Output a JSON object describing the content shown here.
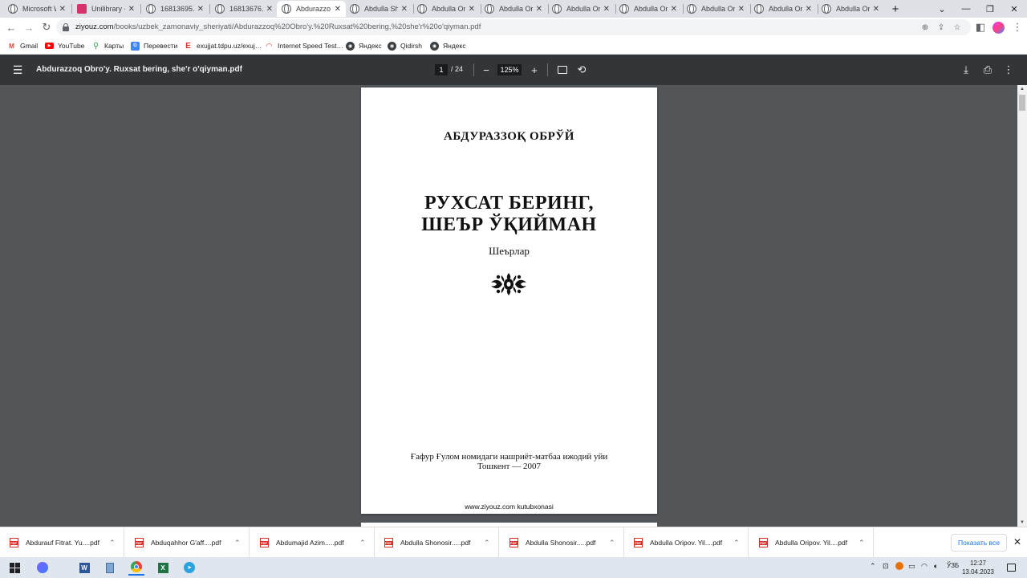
{
  "browser": {
    "tabs": [
      {
        "title": "Microsoft W",
        "icon": "globe-icon"
      },
      {
        "title": "Unilibrary -",
        "icon": "unilibrary-icon"
      },
      {
        "title": "16813695…",
        "icon": "globe-icon"
      },
      {
        "title": "16813676…",
        "icon": "globe-icon"
      },
      {
        "title": "Abdurazzo…",
        "icon": "globe-icon",
        "active": true
      },
      {
        "title": "Abdulla Sh",
        "icon": "globe-icon"
      },
      {
        "title": "Abdulla Ori",
        "icon": "globe-icon"
      },
      {
        "title": "Abdulla Ori",
        "icon": "globe-icon"
      },
      {
        "title": "Abdulla Ori",
        "icon": "globe-icon"
      },
      {
        "title": "Abdulla Ori",
        "icon": "globe-icon"
      },
      {
        "title": "Abdulla Ori",
        "icon": "globe-icon"
      },
      {
        "title": "Abdulla Ori",
        "icon": "globe-icon"
      },
      {
        "title": "Abdulla Ori",
        "icon": "globe-icon"
      }
    ],
    "new_tab_label": "+",
    "url_host": "ziyouz.com",
    "url_path": "/books/uzbek_zamonaviy_sheriyati/Abdurazzoq%20Obro'y.%20Ruxsat%20bering,%20she'r%20o'qiyman.pdf",
    "bookmarks": [
      {
        "label": "Gmail",
        "icon": "gmail-icon"
      },
      {
        "label": "YouTube",
        "icon": "youtube-icon"
      },
      {
        "label": "Карты",
        "icon": "maps-icon"
      },
      {
        "label": "Перевести",
        "icon": "translate-icon"
      },
      {
        "label": "exujjat.tdpu.uz/exuj…",
        "icon": "exujjat-icon"
      },
      {
        "label": "Internet Speed Test…",
        "icon": "speedtest-icon"
      },
      {
        "label": "Яндекс",
        "icon": "globe-icon"
      },
      {
        "label": "Qidirsh",
        "icon": "globe-icon"
      },
      {
        "label": "Яндекс",
        "icon": "globe-icon"
      }
    ]
  },
  "pdf_viewer": {
    "file_title": "Abdurazzoq Obro'y. Ruxsat bering, she'r o'qiyman.pdf",
    "current_page": "1",
    "total_pages": "/ 24",
    "zoom": "125%",
    "page": {
      "author": "АБДУРАЗЗОҚ ОБРЎЙ",
      "title_line1": "РУХСАТ БЕРИНГ,",
      "title_line2": "ШЕЪР ЎҚИЙМАН",
      "genre": "Шеърлар",
      "publisher": "Ғафур Ғулом номидаги нашриёт-матбаа ижодий уйи",
      "city_year": "Тошкент — 2007",
      "watermark": "www.ziyouz.com kutubxonasi"
    }
  },
  "downloads": {
    "items": [
      "Abdurauf Fitrat. Yu....pdf",
      "Abduqahhor G'aff....pdf",
      "Abdumajid Azim.....pdf",
      "Abdulla Shonosir.....pdf",
      "Abdulla Shonosir.....pdf",
      "Abdulla Oripov. Yil....pdf",
      "Abdulla Oripov. Yil....pdf"
    ],
    "show_all_label": "Показать все"
  },
  "taskbar": {
    "lang": "ЎЗБ",
    "time": "12:27",
    "date": "13.04.2023"
  },
  "colors": {
    "pdf_toolbar": "#323639",
    "viewer_bg": "#525659",
    "tab_strip": "#dee1e6",
    "taskbar": "#dfe6ee",
    "link_blue": "#1a73e8"
  }
}
